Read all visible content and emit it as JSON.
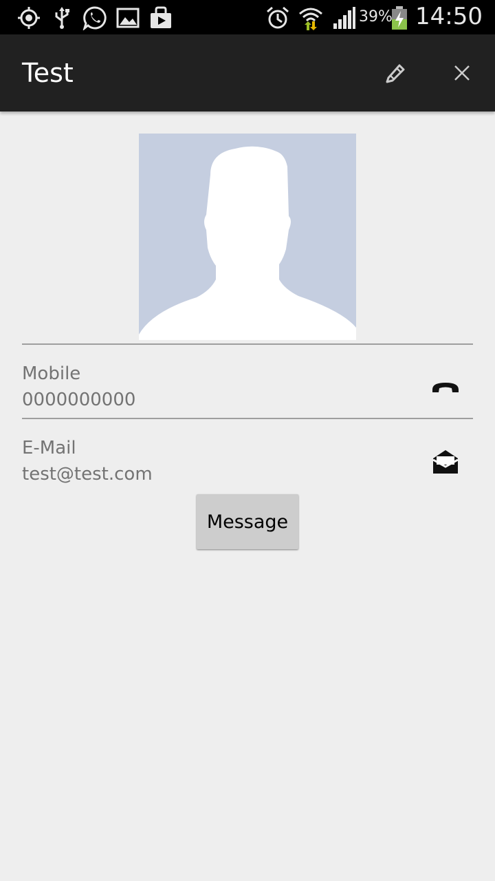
{
  "status_bar": {
    "icons": [
      "location-icon",
      "usb-icon",
      "whatsapp-icon",
      "gallery-icon",
      "store-icon",
      "alarm-icon",
      "wifi-icon",
      "signal-icon",
      "battery-icon"
    ],
    "battery_percent": "39%",
    "time": "14:50"
  },
  "action_bar": {
    "title": "Test",
    "actions": [
      "edit-icon",
      "close-icon"
    ]
  },
  "contact": {
    "avatar": "default-avatar",
    "fields": [
      {
        "label": "Mobile",
        "value": "0000000000",
        "action_icon": "phone-icon"
      },
      {
        "label": "E-Mail",
        "value": "test@test.com",
        "action_icon": "mail-icon"
      }
    ],
    "message_button": "Message"
  },
  "colors": {
    "background": "#eeeeee",
    "action_bar": "#212121",
    "status_bar": "#000000",
    "avatar_bg": "#c5cee0",
    "text_secondary": "#737373",
    "button_bg": "#cdcdcd"
  }
}
